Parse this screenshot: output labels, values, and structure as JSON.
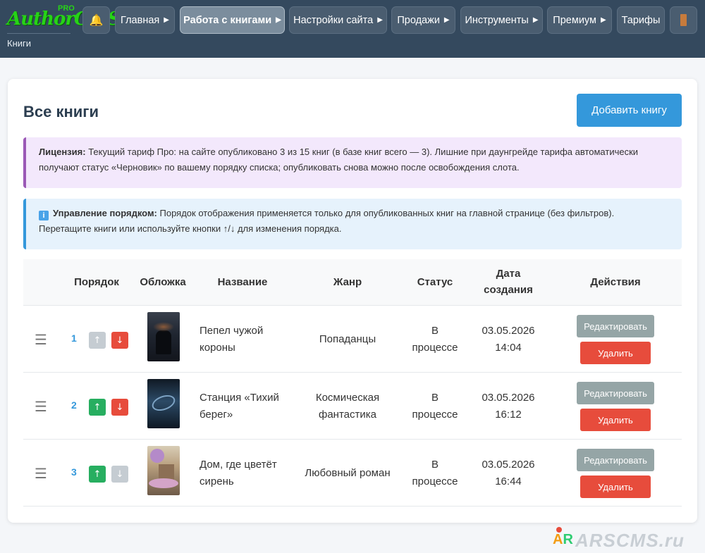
{
  "app": {
    "logo_text": "AuthorCMS",
    "logo_badge": "PRO",
    "breadcrumb": "Книги"
  },
  "nav": {
    "bell_icon": "bell-icon",
    "items": [
      "Главная",
      "Работа с книгами",
      "Настройки сайта",
      "Продажи",
      "Инструменты",
      "Премиум",
      "Тарифы"
    ],
    "active": "Работа с книгами",
    "exit_icon": "door-icon"
  },
  "page": {
    "title": "Все книги",
    "add_button": "Добавить книгу"
  },
  "license_alert": {
    "label": "Лицензия:",
    "text": "Текущий тариф Про: на сайте опубликовано 3 из 15 книг (в базе книг всего — 3). Лишние при даунгрейде тарифа автоматически получают статус «Черновик» по вашему порядку списка; опубликовать снова можно после освобождения слота."
  },
  "order_alert": {
    "icon": "info-icon",
    "label": "Управление порядком:",
    "text": "Порядок отображения применяется только для опубликованных книг на главной странице (без фильтров). Перетащите книги или используйте кнопки ↑/↓ для изменения порядка."
  },
  "table": {
    "headers": {
      "order": "Порядок",
      "cover": "Обложка",
      "name": "Название",
      "genre": "Жанр",
      "status": "Статус",
      "date_l1": "Дата",
      "date_l2": "создания",
      "actions": "Действия"
    },
    "rows": [
      {
        "order": "1",
        "name": "Пепел чужой короны",
        "genre": "Попаданцы",
        "status_l1": "В",
        "status_l2": "процессе",
        "date": "03.05.2026",
        "time": "14:04",
        "up_enabled": false,
        "down_enabled": true,
        "cover_colors": [
          "#2b2f3a",
          "#151820"
        ],
        "edit": "Редактировать",
        "delete": "Удалить"
      },
      {
        "order": "2",
        "name": "Станция «Тихий берег»",
        "genre_l1": "Космическая",
        "genre_l2": "фантастика",
        "status_l1": "В",
        "status_l2": "процессе",
        "date": "03.05.2026",
        "time": "16:12",
        "up_enabled": true,
        "down_enabled": true,
        "cover_colors": [
          "#2c4a66",
          "#0f1c2b"
        ],
        "edit": "Редактировать",
        "delete": "Удалить"
      },
      {
        "order": "3",
        "name": "Дом, где цветёт сирень",
        "genre": "Любовный роман",
        "status_l1": "В",
        "status_l2": "процессе",
        "date": "03.05.2026",
        "time": "16:44",
        "up_enabled": true,
        "down_enabled": false,
        "cover_colors": [
          "#c9b79d",
          "#6b5a4a"
        ],
        "edit": "Редактировать",
        "delete": "Удалить"
      }
    ],
    "arrow_up": "↑",
    "arrow_down": "↓",
    "drag_glyph": "☰"
  },
  "watermark": {
    "ar_a": "A",
    "ar_r": "R",
    "text": "ARSCMS.ru"
  }
}
